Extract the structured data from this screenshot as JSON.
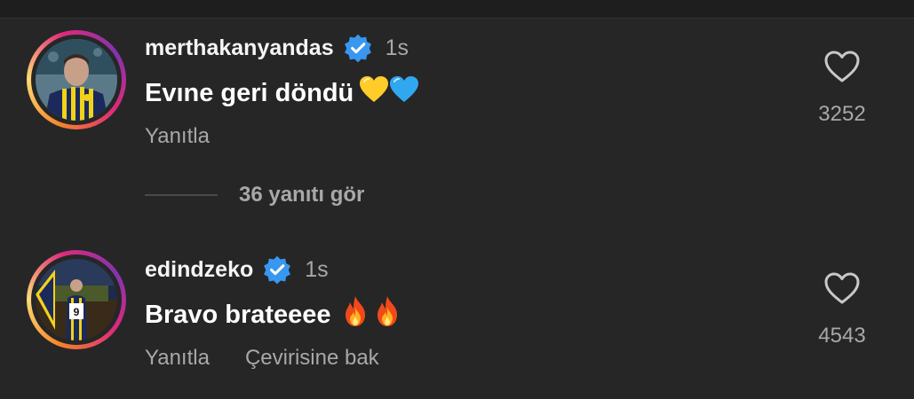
{
  "comments": [
    {
      "username": "merthakanyandas",
      "time": "1s",
      "text": "Evıne geri döndü",
      "emojis": [
        "yellow-heart",
        "blue-heart"
      ],
      "reply_label": "Yanıtla",
      "like_count": "3252"
    },
    {
      "username": "edindzeko",
      "time": "1s",
      "text": "Bravo brateeee",
      "emojis": [
        "fire",
        "fire"
      ],
      "reply_label": "Yanıtla",
      "translate_label": "Çevirisine bak",
      "like_count": "4543"
    }
  ],
  "view_replies_label": "36 yanıtı gör",
  "colors": {
    "background": "#262626",
    "verified": "#3897f0",
    "muted_text": "#a8a8a8"
  }
}
